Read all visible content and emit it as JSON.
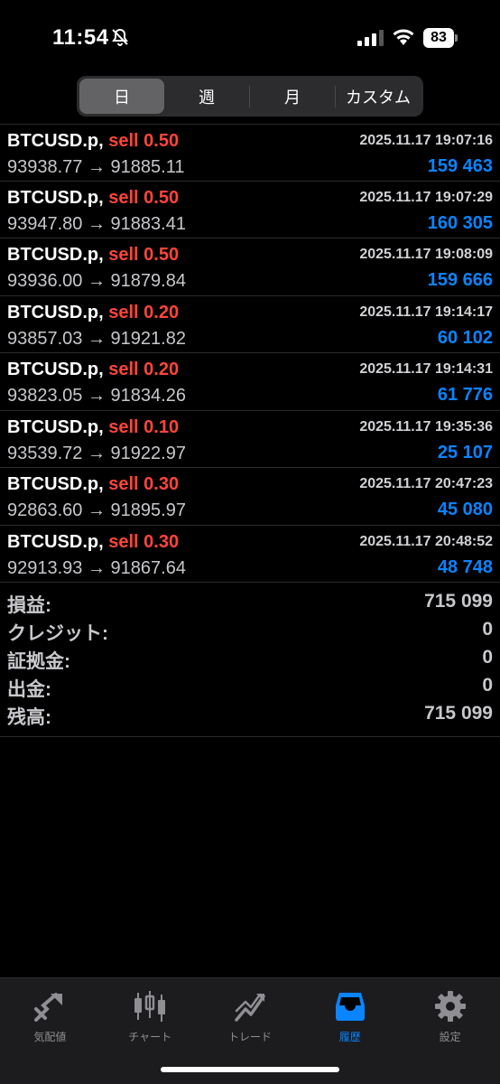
{
  "status": {
    "time": "11:54",
    "battery": "83"
  },
  "segments": [
    {
      "label": "日"
    },
    {
      "label": "週"
    },
    {
      "label": "月"
    },
    {
      "label": "カスタム"
    }
  ],
  "deals": [
    {
      "symbol": "BTCUSD.p,",
      "side": "sell 0.50",
      "time": "2025.11.17 19:07:16",
      "prices": "93938.77 → 91885.11",
      "profit": "159 463"
    },
    {
      "symbol": "BTCUSD.p,",
      "side": "sell 0.50",
      "time": "2025.11.17 19:07:29",
      "prices": "93947.80 → 91883.41",
      "profit": "160 305"
    },
    {
      "symbol": "BTCUSD.p,",
      "side": "sell 0.50",
      "time": "2025.11.17 19:08:09",
      "prices": "93936.00 → 91879.84",
      "profit": "159 666"
    },
    {
      "symbol": "BTCUSD.p,",
      "side": "sell 0.20",
      "time": "2025.11.17 19:14:17",
      "prices": "93857.03 → 91921.82",
      "profit": "60 102"
    },
    {
      "symbol": "BTCUSD.p,",
      "side": "sell 0.20",
      "time": "2025.11.17 19:14:31",
      "prices": "93823.05 → 91834.26",
      "profit": "61 776"
    },
    {
      "symbol": "BTCUSD.p,",
      "side": "sell 0.10",
      "time": "2025.11.17 19:35:36",
      "prices": "93539.72 → 91922.97",
      "profit": "25 107"
    },
    {
      "symbol": "BTCUSD.p,",
      "side": "sell 0.30",
      "time": "2025.11.17 20:47:23",
      "prices": "92863.60 → 91895.97",
      "profit": "45 080"
    },
    {
      "symbol": "BTCUSD.p,",
      "side": "sell 0.30",
      "time": "2025.11.17 20:48:52",
      "prices": "92913.93 → 91867.64",
      "profit": "48 748"
    }
  ],
  "summary": [
    {
      "label": "損益:",
      "value": "715 099"
    },
    {
      "label": "クレジット:",
      "value": "0"
    },
    {
      "label": "証拠金:",
      "value": "0"
    },
    {
      "label": "出金:",
      "value": "0"
    },
    {
      "label": "残高:",
      "value": "715 099"
    }
  ],
  "tabs": [
    {
      "label": "気配値",
      "icon": "quotes-icon"
    },
    {
      "label": "チャート",
      "icon": "chart-icon"
    },
    {
      "label": "トレード",
      "icon": "trade-icon"
    },
    {
      "label": "履歴",
      "icon": "history-icon"
    },
    {
      "label": "設定",
      "icon": "settings-icon"
    }
  ],
  "colors": {
    "sell": "#ff453a",
    "profit": "#0a84ff",
    "active_tab": "#0a84ff"
  }
}
